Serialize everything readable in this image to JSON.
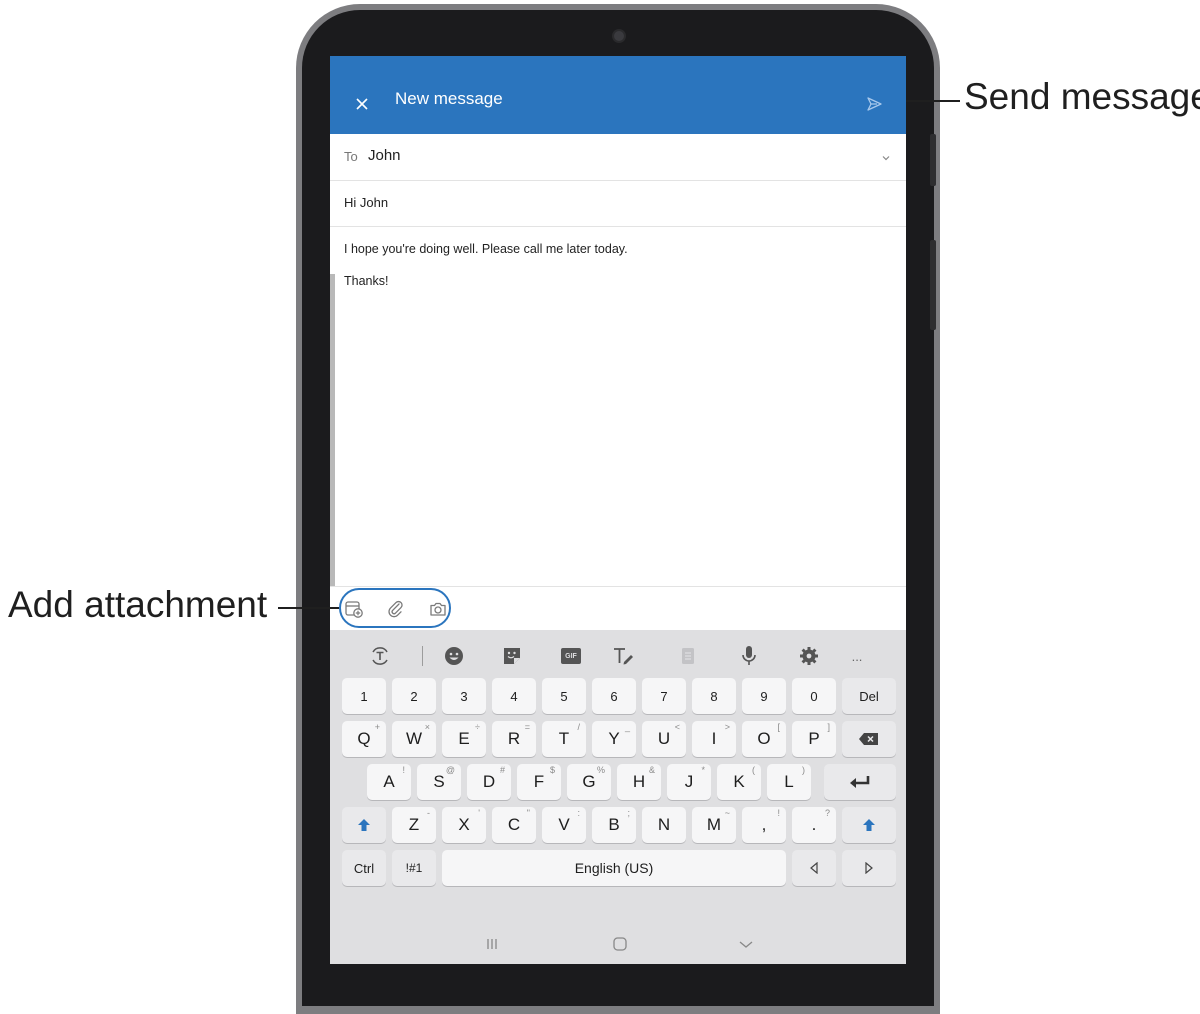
{
  "app": {
    "title": "New message",
    "accent_color": "#2b75be"
  },
  "compose": {
    "to_label": "To",
    "to_value": "John",
    "subject": "Hi John",
    "body_lines": [
      "I hope you're  doing well. Please call me later today.",
      "Thanks!"
    ]
  },
  "attachment_icons": [
    "add-file-icon",
    "paperclip-icon",
    "camera-icon"
  ],
  "keyboard": {
    "toolbar": [
      "text-recognition-icon",
      "emoji-icon",
      "sticker-icon",
      "gif-icon",
      "handwriting-icon",
      "clipboard-icon",
      "microphone-icon",
      "settings-icon",
      "more-icon"
    ],
    "gif_label": "GIF",
    "more_label": "...",
    "number_row": [
      "1",
      "2",
      "3",
      "4",
      "5",
      "6",
      "7",
      "8",
      "9",
      "0",
      "Del"
    ],
    "row1": [
      {
        "k": "Q",
        "h": "+"
      },
      {
        "k": "W",
        "h": "×"
      },
      {
        "k": "E",
        "h": "÷"
      },
      {
        "k": "R",
        "h": "="
      },
      {
        "k": "T",
        "h": "/"
      },
      {
        "k": "Y",
        "h": "_"
      },
      {
        "k": "U",
        "h": "<"
      },
      {
        "k": "I",
        "h": ">"
      },
      {
        "k": "O",
        "h": "["
      },
      {
        "k": "P",
        "h": "]"
      }
    ],
    "row2": [
      {
        "k": "A",
        "h": "!"
      },
      {
        "k": "S",
        "h": "@"
      },
      {
        "k": "D",
        "h": "#"
      },
      {
        "k": "F",
        "h": "$"
      },
      {
        "k": "G",
        "h": "%"
      },
      {
        "k": "H",
        "h": "&"
      },
      {
        "k": "J",
        "h": "*"
      },
      {
        "k": "K",
        "h": "("
      },
      {
        "k": "L",
        "h": ")"
      }
    ],
    "row3": [
      {
        "k": "Z",
        "h": "-"
      },
      {
        "k": "X",
        "h": "'"
      },
      {
        "k": "C",
        "h": "\""
      },
      {
        "k": "V",
        "h": ":"
      },
      {
        "k": "B",
        "h": ";"
      },
      {
        "k": "N",
        "h": ""
      },
      {
        "k": "M",
        "h": "~"
      },
      {
        "k": ",",
        "h": "!"
      },
      {
        "k": ".",
        "h": "?"
      }
    ],
    "ctrl_label": "Ctrl",
    "symbols_label": "!#1",
    "space_label": "English (US)"
  },
  "callouts": {
    "send": "Send message",
    "attach": "Add attachment"
  }
}
